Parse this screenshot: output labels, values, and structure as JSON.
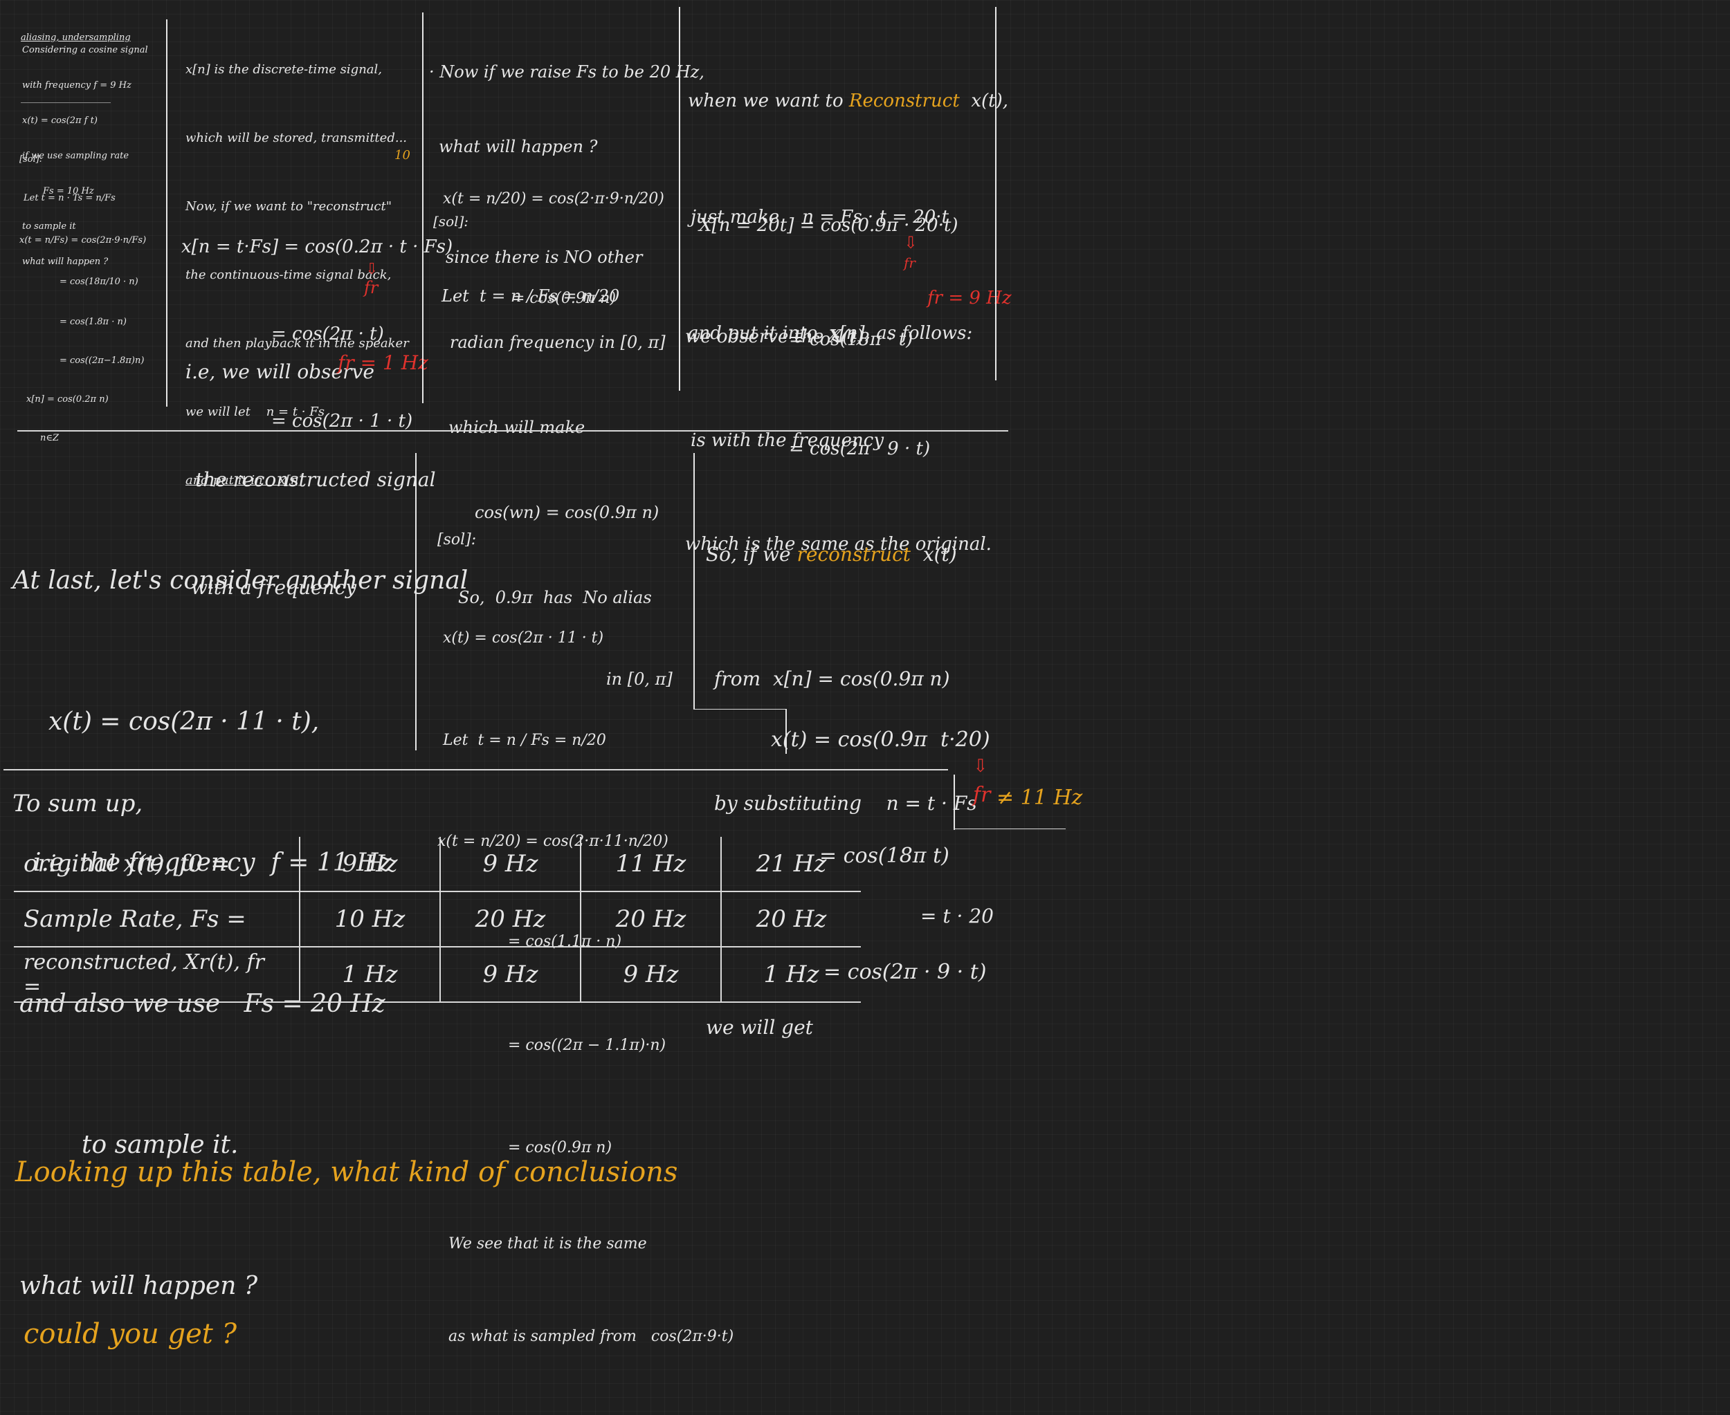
{
  "panel1": {
    "title": "aliasing, undersampling",
    "intro": [
      "Considering a cosine signal",
      "with frequency f = 9 Hz",
      "x(t) = cos(2π f t)",
      "if we use sampling rate",
      "Fs = 10 Hz",
      "to sample it",
      "what will happen ?"
    ],
    "solution_label": "[sol]:",
    "solution": [
      "Let t = n · Ts = n/Fs",
      "x(t = n/Fs) = cos(2π·9·n/Fs)",
      "= cos(18π/10 · n)",
      "= cos(1.8π · n)",
      "= cos((2π−1.8π)n)",
      "x[n] = cos(0.2π n)",
      "n∈Z"
    ]
  },
  "panel2": {
    "lines": [
      "x[n] is the discrete-time signal,",
      "which will be stored, transmitted...",
      "Now, if we want to \"reconstruct\"",
      "the continuous-time signal back,",
      "and then playback it in the speaker",
      "we will let    n = t · Fs",
      "and put it in    x[n]"
    ],
    "annot_10": "10",
    "equations": [
      "x[n = t·Fs] = cos(0.2π · t · Fs)",
      "= cos(2π · t)",
      "= cos(2π · 1 · t)"
    ],
    "fr_symbol": "fr",
    "conclusion": [
      "i.e, we will observe",
      "the reconstructed signal",
      "with a frequency"
    ],
    "fr_value": "fr = 1 Hz"
  },
  "panel3": {
    "lines": [
      "· Now if we raise Fs to be 20 Hz,",
      "what will happen ?",
      "[sol]:",
      "Let  t = n / Fs = n/20"
    ],
    "equations": [
      "x(t = n/20) = cos(2·π·9·n/20)",
      "= cos(0.9π n)"
    ],
    "text": [
      "since there is NO other",
      "radian frequency in [0, π]",
      "which will make",
      "cos(wn) = cos(0.9π n)",
      "So,  0.9π  has  No alias",
      "in [0, π]"
    ]
  },
  "panel4": {
    "lines": [
      "when we want to",
      "just make    n = Fs · t = 20·t",
      "and put it into  x[n], as follows:"
    ],
    "reconstruct": "Reconstruct",
    "xt": "x(t),",
    "equations": [
      "X[n = 20t] = cos(0.9π · 20·t)",
      "= cos(18π · t)",
      "= cos(2π · 9 · t)"
    ],
    "observe": [
      "we observe the X(t)",
      "is with the frequency",
      "which is the same as the original."
    ],
    "fr_symbol": "fr",
    "fr_value": "fr = 9 Hz"
  },
  "section2": {
    "intro": [
      "At last, let's consider another signal",
      "x(t) = cos(2π · 11 · t),",
      "i.e, the frequency  f = 11 Hz",
      "and also we use   Fs = 20 Hz",
      "to sample it.",
      "what will happen ?"
    ],
    "solution_label": "[sol]:",
    "solution": [
      "x(t) = cos(2π · 11 · t)",
      "Let  t = n / Fs = n/20",
      "x(t = n/20) = cos(2·π·11·n/20)",
      "= cos(1.1π · n)",
      "= cos((2π − 1.1π)·n)",
      "= cos(0.9π n)",
      "We see that it is the same",
      "as what is sampled from   cos(2π·9·t)"
    ],
    "reconstruct_lines": [
      "So, if we",
      "from  x[n] = cos(0.9π n)",
      "by substituting    n = t · Fs",
      "= t · 20",
      "we will get"
    ],
    "reconstruct_word": "reconstruct",
    "xt": "x(t)",
    "equations": [
      "x(t) = cos(0.9π  t·20)",
      "= cos(18π t)",
      "= cos(2π · 9 · t)"
    ],
    "fr_result_symbol": "fr",
    "fr_result": "≠ 11 Hz"
  },
  "summary": {
    "title": "To sum up,",
    "rows": [
      {
        "label": "original x(t), f0 =",
        "values": [
          "9 Hz",
          "9 Hz",
          "11 Hz",
          "21 Hz"
        ]
      },
      {
        "label": "Sample Rate,  Fs =",
        "values": [
          "10 Hz",
          "20 Hz",
          "20 Hz",
          "20 Hz"
        ]
      },
      {
        "label": "reconstructed, Xr(t), fr =",
        "values": [
          "1 Hz",
          "9 Hz",
          "9 Hz",
          "1 Hz"
        ]
      }
    ],
    "question": [
      "Looking up this table, what kind of conclusions",
      "could you get ?"
    ]
  },
  "colors": {
    "background": "#1f1f1f",
    "ink": "#e6e6e6",
    "orange": "#e6a31e",
    "red": "#e0322d"
  }
}
